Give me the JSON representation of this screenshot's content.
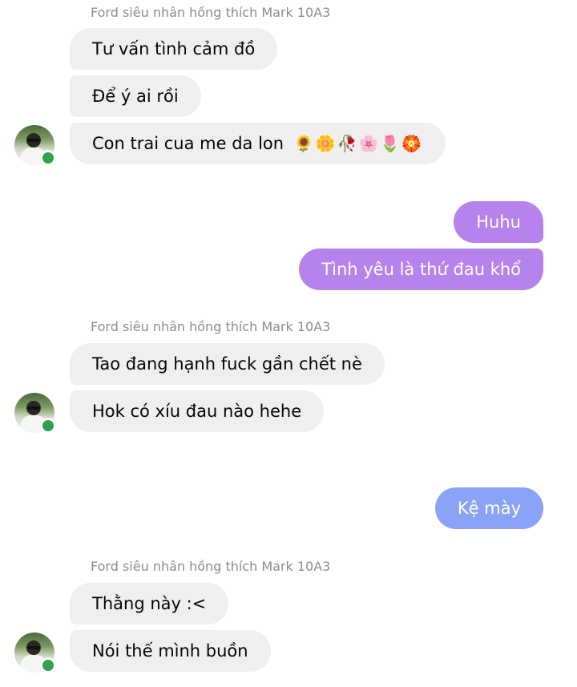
{
  "groups": [
    {
      "sender": "Ford siêu nhân hồng thích Mark 10A3",
      "messages": [
        "Tư vấn tình cảm đồ",
        "Để ý ai rồi",
        "Con trai cua me da lon"
      ],
      "emojis": [
        "🌻",
        "🌼",
        "🥀",
        "🌸",
        "🌷",
        "🏵️"
      ]
    },
    {
      "messages": [
        "Huhu",
        "Tình yêu là thứ đau khổ"
      ]
    },
    {
      "sender": "Ford siêu nhân hồng thích Mark 10A3",
      "messages": [
        "Tao đang hạnh fuck gần chết nè",
        "Hok có xíu đau nào hehe"
      ]
    },
    {
      "messages": [
        "Kệ mày"
      ]
    },
    {
      "sender": "Ford siêu nhân hồng thích Mark 10A3",
      "messages": [
        "Thằng này :<",
        "Nói thế mình buồn"
      ]
    }
  ],
  "colors": {
    "incoming_bubble": "#efefef",
    "outgoing_purple": "#b683ec",
    "outgoing_blue": "#8aa3f7",
    "online_dot": "#31a24c"
  },
  "icons": {
    "avatar": "user-avatar",
    "online": "online-status-dot"
  }
}
